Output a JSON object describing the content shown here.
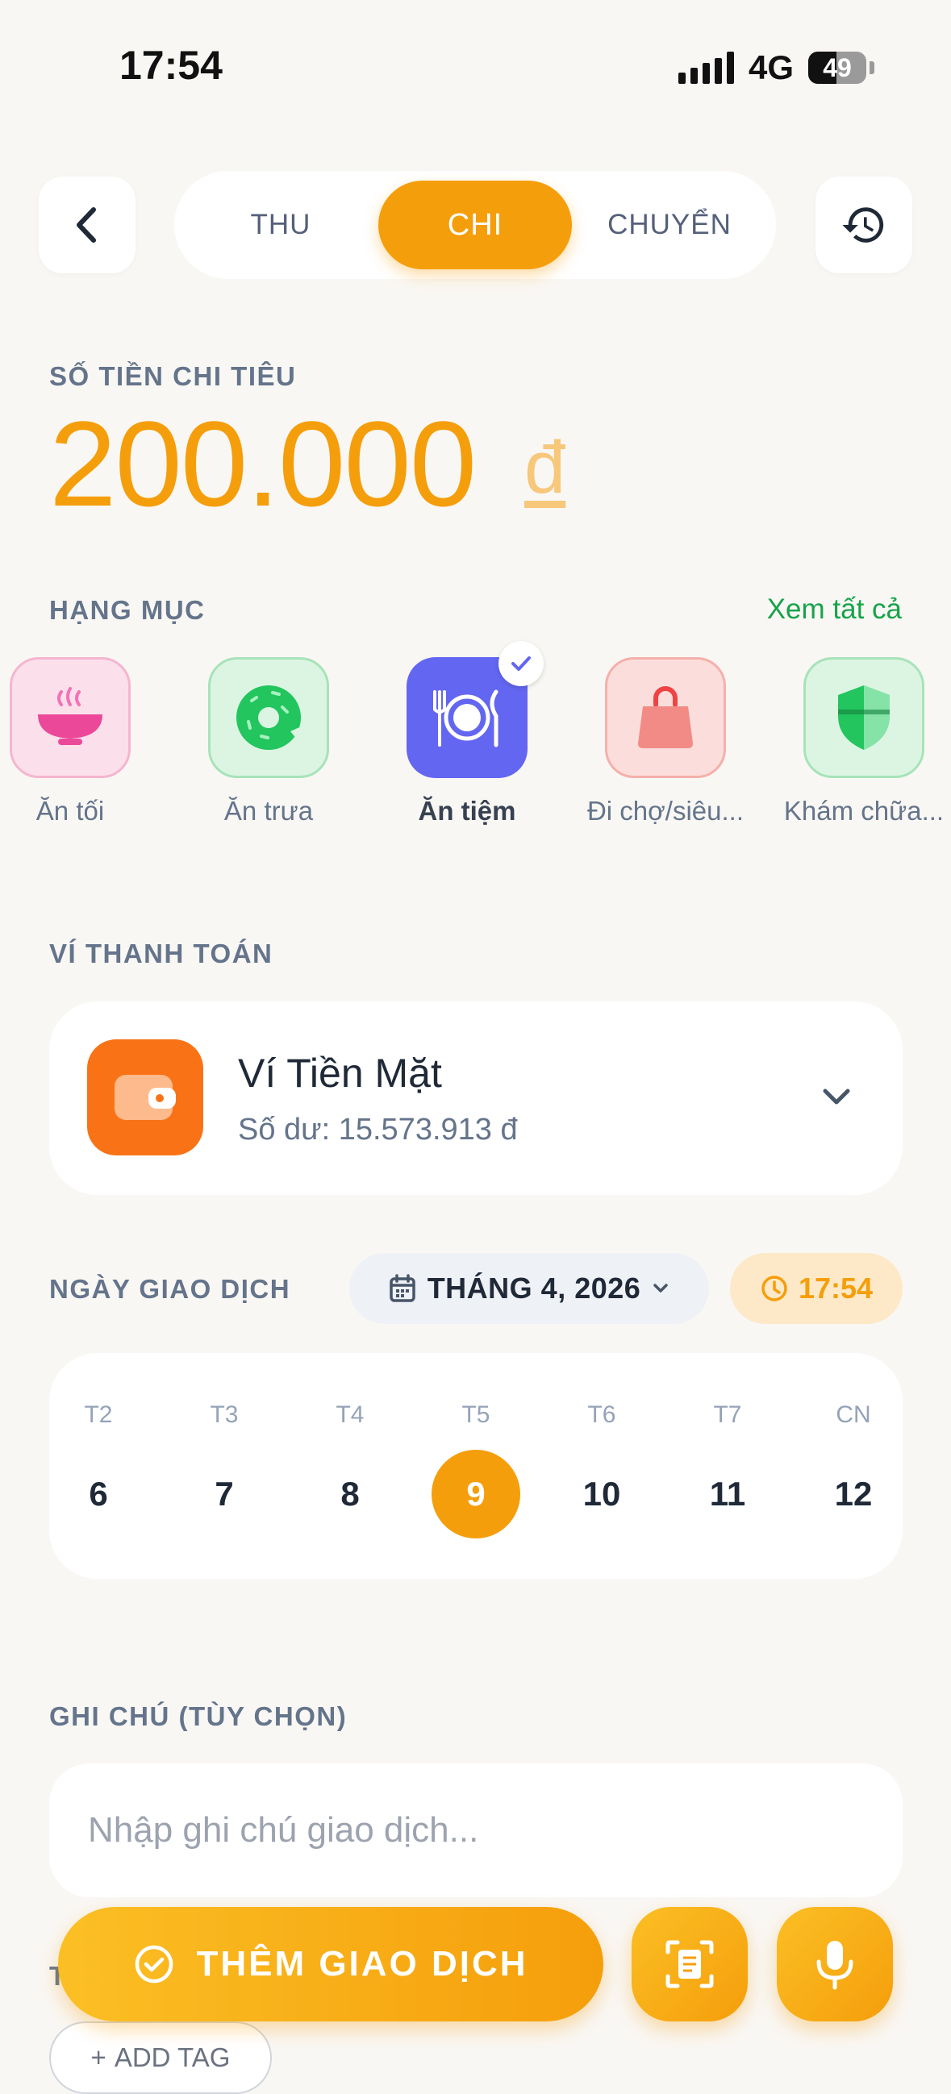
{
  "status_bar": {
    "time": "17:54",
    "network": "4G",
    "battery": "49"
  },
  "tabs": [
    {
      "label": "THU",
      "active": false
    },
    {
      "label": "CHI",
      "active": true
    },
    {
      "label": "CHUYỂN",
      "active": false
    }
  ],
  "amount": {
    "label": "SỐ TIỀN CHI TIÊU",
    "value": "200.000",
    "currency": "đ"
  },
  "categories": {
    "label": "HẠNG MỤC",
    "see_all": "Xem tất cả",
    "items": [
      {
        "name": "Ăn tối",
        "icon": "bowl-icon",
        "color": "#ec4899",
        "selected": false
      },
      {
        "name": "Ăn trưa",
        "icon": "donut-icon",
        "color": "#22c55e",
        "selected": false
      },
      {
        "name": "Ăn tiệm",
        "icon": "dining-plate-icon",
        "color": "#6366f1",
        "selected": true
      },
      {
        "name": "Đi chợ/siêu...",
        "icon": "shopping-bag-icon",
        "color": "#ef4444",
        "selected": false
      },
      {
        "name": "Khám chữa...",
        "icon": "shield-icon",
        "color": "#22c55e",
        "selected": false
      }
    ]
  },
  "wallet": {
    "label": "VÍ THANH TOÁN",
    "name": "Ví Tiền Mặt",
    "balance": "Số dư: 15.573.913 đ",
    "icon": "wallet-icon",
    "color": "#f97316"
  },
  "date": {
    "label": "NGÀY GIAO DỊCH",
    "month": "THÁNG 4, 2026",
    "time": "17:54",
    "days": [
      {
        "dow": "T2",
        "num": "6",
        "selected": false
      },
      {
        "dow": "T3",
        "num": "7",
        "selected": false
      },
      {
        "dow": "T4",
        "num": "8",
        "selected": false
      },
      {
        "dow": "T5",
        "num": "9",
        "selected": true
      },
      {
        "dow": "T6",
        "num": "10",
        "selected": false
      },
      {
        "dow": "T7",
        "num": "11",
        "selected": false
      },
      {
        "dow": "CN",
        "num": "12",
        "selected": false
      }
    ]
  },
  "note": {
    "label": "GHI CHÚ (TÙY CHỌN)",
    "placeholder": "Nhập ghi chú giao dịch..."
  },
  "tags": {
    "label": "T",
    "add_label": "ADD TAG"
  },
  "actions": {
    "add_transaction": "THÊM GIAO DỊCH"
  },
  "colors": {
    "accent": "#f59e0b",
    "link": "#16a34a"
  }
}
